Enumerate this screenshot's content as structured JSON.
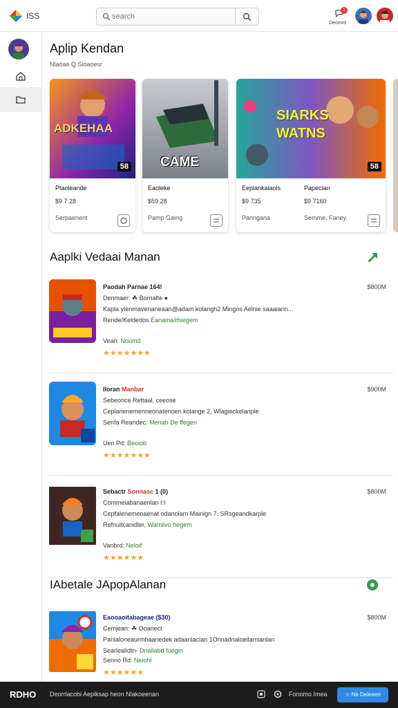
{
  "header": {
    "logo_text": "ISS",
    "search_placeholder": "search",
    "notification_count": "1",
    "notification_label": "Deomrd"
  },
  "page": {
    "title": "Aplip Kendan",
    "breadcrumb": "Nlaoae  Q Sioaoesr"
  },
  "featured": [
    {
      "art_text": "ADKEHAA",
      "badge": "58",
      "title": "Ptaoleande",
      "price": "$9 7 28",
      "meta": "Serpaenent",
      "title2": "",
      "price2": "",
      "meta2": ""
    },
    {
      "art_text": "CAME",
      "badge": "",
      "title": "Eaoleke",
      "price": "$59 28",
      "meta": "Pamp Gaing",
      "title2": "",
      "price2": "",
      "meta2": ""
    },
    {
      "art_text": "SIARKS WATNS",
      "badge": "58",
      "title": "Eeplankaiaols",
      "price": "$9 735",
      "meta": "Panngana",
      "title2": "Papecian",
      "price2": "$9 7160",
      "meta2": "Semme, Faney."
    }
  ],
  "section1": {
    "title": "Aaplki Vedaai Manan"
  },
  "section2": {
    "title": "IAbetale JApopAlanan"
  },
  "apps": [
    {
      "title_a": "Paodah Parnae",
      "title_b": "",
      "title_c": " 164!",
      "sub": "Denmaer:  ☘ Bornalte ●",
      "desc": "Kapla ytenmavenaneaan@adam kolangh2 Mingos  Aelnie saaaiann...",
      "desc2_a": "Rende/Keldedos ",
      "desc2_b": "Eanaina/rhiegem",
      "ver_a": "Vean: ",
      "ver_b": "Noumd",
      "stars": "★★★★★★★",
      "size": "$800M"
    },
    {
      "title_a": "Iloran ",
      "title_b": "Manbar",
      "title_c": "",
      "sub": "Sebeonce Rettaal, ceeose",
      "desc": "Ceplarienemenneonatenoen.kolange 2, Wlagieckelanple",
      "desc2_a": "Senfa Reandec. ",
      "desc2_b": "Menah De ffegen",
      "ver_a": "Uen Pd: ",
      "ver_b": "Beoiob",
      "stars": "★★★★★★★",
      "size": "$900M"
    },
    {
      "title_a": "Sebactr ",
      "title_b": "Sonnasc",
      "title_c": "  1 (0)",
      "sub": "Commeiabanaenlan  I:I",
      "desc": "Cepfalenemenaenat odanolam Mainign 7. SRsgeandkarple",
      "desc2_a": "Refnuitcanidler, ",
      "desc2_b": "Wamiivo hegem",
      "ver_a": "Vanbrd: ",
      "ver_b": "Neloif",
      "stars": "★★★★★★",
      "size": "$800M"
    },
    {
      "title_a": "Eaooaoitabageae",
      "title_b": "",
      "title_c": " ($30)",
      "sub": "Cemjean:  ☘ Ooanect",
      "desc": "Panlaloneaurmbaanedek adaanlacian 1Onnadnaloeilamianlan",
      "desc2_a": "Searlealidtn- ",
      "desc2_b": "Dnailabd fuegin",
      "ver_a": "Senno Rd: ",
      "ver_b": "Neiohl",
      "stars": "★★★★★★",
      "size": "$800M"
    }
  ],
  "footer": {
    "brand": "RDHO",
    "tagline": "Deorrlacobi Aepiksap heon Nlakoeenan",
    "link": "Fonomo Imea",
    "cta": "☆ Ne Deleeen"
  },
  "colors": {
    "accent": "#2f8ae5",
    "star": "#f5a623",
    "green": "#2e7d32",
    "red": "#d32f2f"
  }
}
